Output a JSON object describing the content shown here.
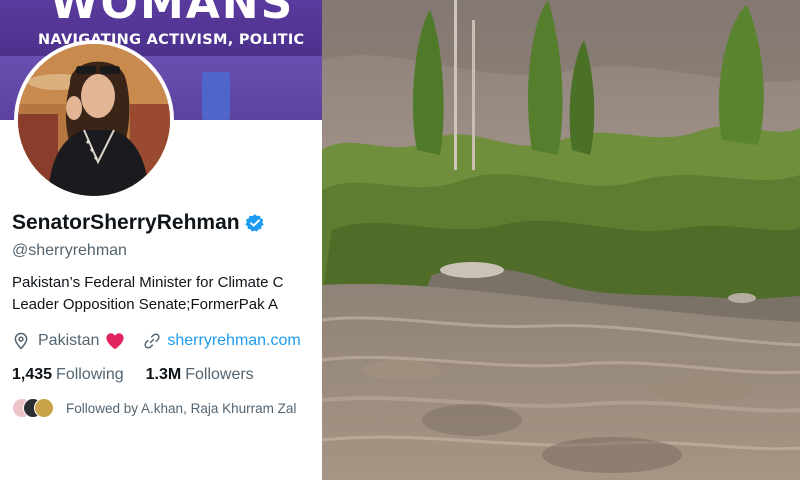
{
  "profile": {
    "banner": {
      "title": "WOMANS",
      "subtitle": "NAVIGATING ACTIVISM, POLITIC"
    },
    "display_name": "SenatorSherryRehman",
    "handle": "@sherryrehman",
    "bio_lines": [
      "Pakistan’s Federal Minister for Climate C",
      "Leader Opposition Senate;FormerPak A"
    ],
    "location": "Pakistan",
    "website": "sherryrehman.com",
    "following": {
      "count": "1,435",
      "label": "Following"
    },
    "followers": {
      "count": "1.3M",
      "label": "Followers"
    },
    "followed_by": "Followed by A.khan, Raja Khurram Zal"
  },
  "colors": {
    "verified": "#1d9bf0",
    "link": "#1d9bf0",
    "secondary_text": "#536471",
    "heart": "#e0245e",
    "banner": "#4a2f88"
  },
  "icons": {
    "verified": "verified-badge-icon",
    "location": "location-pin-icon",
    "heart": "heart-icon",
    "link": "link-icon"
  }
}
